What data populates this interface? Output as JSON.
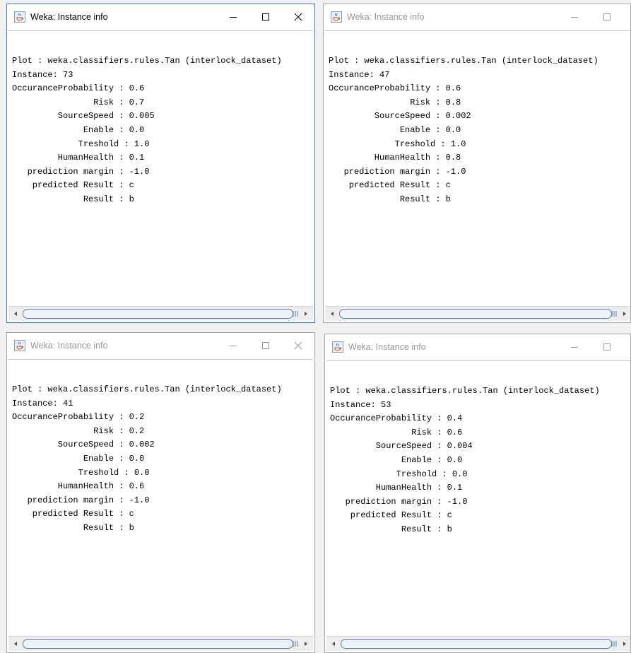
{
  "windows": [
    {
      "title": "Weka: Instance info",
      "active": true,
      "lines": [
        "Plot : weka.classifiers.rules.Tan (interlock_dataset)",
        "Instance: 73",
        "OccuranceProbability : 0.6",
        "                Risk : 0.7",
        "         SourceSpeed : 0.005",
        "              Enable : 0.0",
        "             Treshold : 1.0",
        "         HumanHealth : 0.1",
        "   prediction margin : -1.0",
        "    predicted Result : c",
        "              Result : b"
      ]
    },
    {
      "title": "Weka: Instance info",
      "active": false,
      "lines": [
        "Plot : weka.classifiers.rules.Tan (interlock_dataset)",
        "Instance: 47",
        "OccuranceProbability : 0.6",
        "                Risk : 0.8",
        "         SourceSpeed : 0.002",
        "              Enable : 0.0",
        "             Treshold : 1.0",
        "         HumanHealth : 0.8",
        "   prediction margin : -1.0",
        "    predicted Result : c",
        "              Result : b"
      ]
    },
    {
      "title": "Weka: Instance info",
      "active": false,
      "lines": [
        "Plot : weka.classifiers.rules.Tan (interlock_dataset)",
        "Instance: 41",
        "OccuranceProbability : 0.2",
        "                Risk : 0.2",
        "         SourceSpeed : 0.002",
        "              Enable : 0.0",
        "             Treshold : 0.0",
        "         HumanHealth : 0.6",
        "   prediction margin : -1.0",
        "    predicted Result : c",
        "              Result : b"
      ]
    },
    {
      "title": "Weka: Instance info",
      "active": false,
      "lines": [
        "Plot : weka.classifiers.rules.Tan (interlock_dataset)",
        "Instance: 53",
        "OccuranceProbability : 0.4",
        "                Risk : 0.6",
        "         SourceSpeed : 0.004",
        "              Enable : 0.0",
        "             Treshold : 0.0",
        "         HumanHealth : 0.1",
        "   prediction margin : -1.0",
        "    predicted Result : c",
        "              Result : b"
      ]
    }
  ],
  "icons": {
    "app": "java-cup-icon",
    "minimize": "minimize-icon",
    "maximize": "maximize-icon",
    "close": "close-icon",
    "scroll_left": "scroll-left-arrow-icon",
    "scroll_right": "scroll-right-arrow-icon"
  },
  "colors": {
    "active_border": "#3c7fb1",
    "inactive_title": "#999999",
    "scroll_thumb_border": "#5b7fa6"
  }
}
